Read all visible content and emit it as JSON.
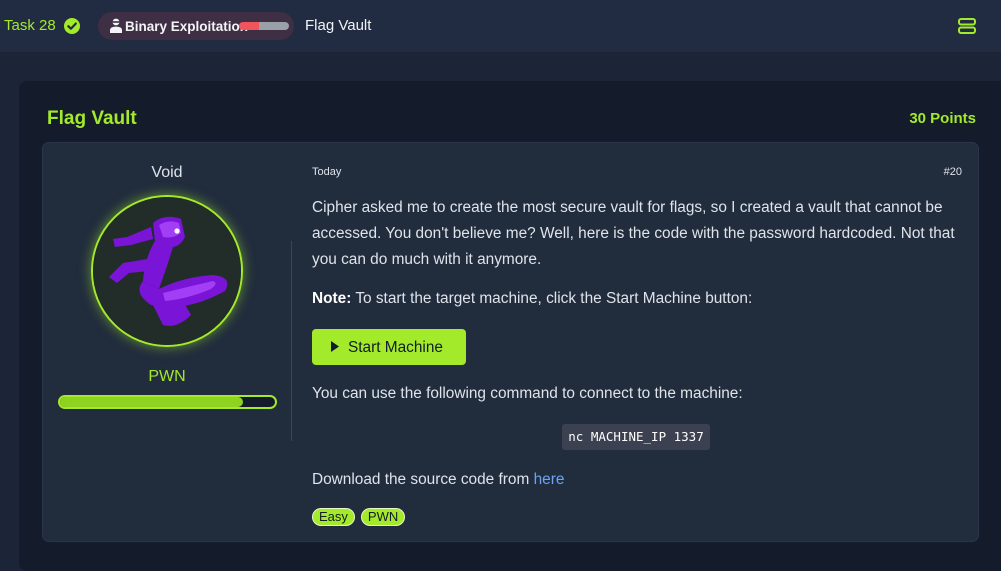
{
  "topbar": {
    "task_label": "Task 28",
    "category": {
      "name": "Binary Exploitation",
      "difficulty_level": 2,
      "difficulty_max": 5,
      "active_color": "#f0555e",
      "inactive_color": "#9aa0a8"
    },
    "title": "Flag Vault",
    "icons": [
      "check-icon",
      "hacker-icon",
      "menu-icon"
    ]
  },
  "card": {
    "title": "Flag Vault",
    "points": "30 Points"
  },
  "author": {
    "name": "Void",
    "rank": "PWN",
    "progress": 0.85
  },
  "post": {
    "date": "Today",
    "number": "#20",
    "description": "Cipher asked me to create the most secure vault for flags, so I created a vault that cannot be accessed. You don't believe me? Well, here is the code with the password hardcoded. Not that you can do much with it anymore.",
    "note_label": "Note:",
    "note_text": " To start the target machine, click the Start Machine button:",
    "start_button": "Start Machine",
    "connect_text": "You can use the following command to connect to the machine:",
    "command": "nc MACHINE_IP 1337",
    "download_text": "Download the source code from ",
    "download_link": "here",
    "tags": [
      "Easy",
      "PWN"
    ]
  },
  "colors": {
    "accent": "#a3ea2a",
    "link": "#6ca3f5",
    "background": "#1c2538",
    "card": "#141c2b",
    "panel": "#212c3d"
  }
}
